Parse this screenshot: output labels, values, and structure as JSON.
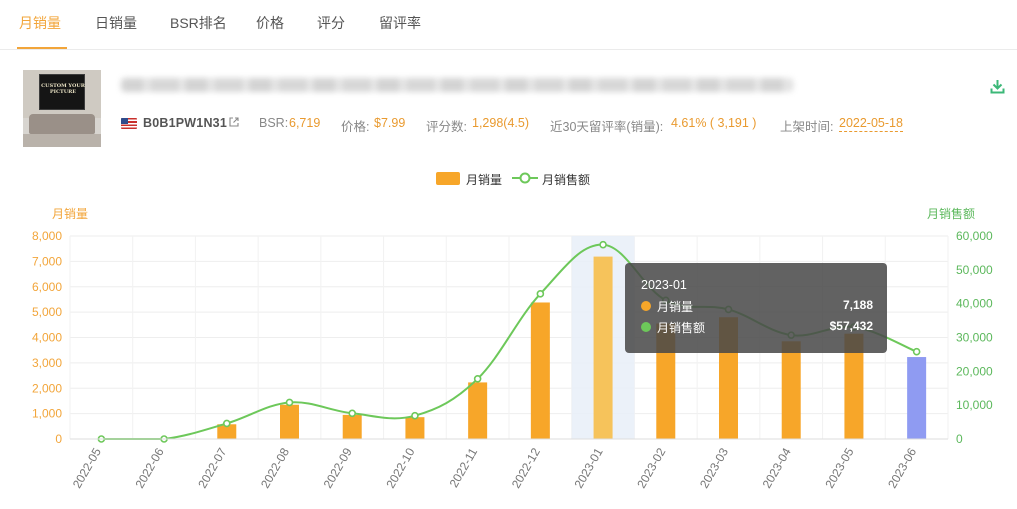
{
  "tabs": [
    {
      "label": "月销量",
      "active": true
    },
    {
      "label": "日销量",
      "active": false
    },
    {
      "label": "BSR排名",
      "active": false
    },
    {
      "label": "价格",
      "active": false
    },
    {
      "label": "评分",
      "active": false
    },
    {
      "label": "留评率",
      "active": false
    }
  ],
  "product": {
    "image_text": "CUSTOM YOUR PICTURE",
    "asin": "B0B1PW1N31",
    "marketplace_flag": "us-flag-icon",
    "bsr_label": "BSR:",
    "bsr_value": "6,719",
    "price_label": "价格:",
    "price_value": "$7.99",
    "ratings_label": "评分数:",
    "ratings_value": "1,298(4.5)",
    "review_rate_label": "近30天留评率(销量):",
    "review_rate_value": "4.61% ( 3,191 )",
    "listed_label": "上架时间:",
    "listed_value": "2022-05-18"
  },
  "icons": {
    "download": "download-icon",
    "external_link": "external-link-icon"
  },
  "colors": {
    "accent": "#f2a53a",
    "bar": "#f7a629",
    "bar_highlight": "#f6c35b",
    "bar_current": "#8f9bf2",
    "line": "#6dc85a",
    "green_text": "#5cb85c"
  },
  "tooltip": {
    "title": "2023-01",
    "rows": [
      {
        "name": "月销量",
        "value": "7,188",
        "color": "#f7a629"
      },
      {
        "name": "月销售额",
        "value": "$57,432",
        "color": "#6dc85a"
      }
    ]
  },
  "chart_data": {
    "type": "bar",
    "categories": [
      "2022-05",
      "2022-06",
      "2022-07",
      "2022-08",
      "2022-09",
      "2022-10",
      "2022-11",
      "2022-12",
      "2023-01",
      "2023-02",
      "2023-03",
      "2023-04",
      "2023-05",
      "2023-06"
    ],
    "series": [
      {
        "name": "月销量",
        "type": "bar",
        "axis": "left",
        "values": [
          0,
          0,
          580,
          1350,
          950,
          860,
          2230,
          5380,
          7188,
          4550,
          4800,
          3850,
          4150,
          3230
        ]
      },
      {
        "name": "月销售额",
        "type": "line",
        "axis": "right",
        "values": [
          0,
          0,
          4600,
          10800,
          7600,
          6900,
          17800,
          42900,
          57432,
          41000,
          38300,
          30700,
          33100,
          25800
        ]
      }
    ],
    "highlight_index": 8,
    "current_index": 13,
    "ylabel_left": "月销量",
    "ylabel_right": "月销售额",
    "ylim_left": [
      0,
      8000
    ],
    "ylim_right": [
      0,
      60000
    ],
    "yticks_left": [
      "0",
      "1,000",
      "2,000",
      "3,000",
      "4,000",
      "5,000",
      "6,000",
      "7,000",
      "8,000"
    ],
    "yticks_right": [
      "0",
      "10,000",
      "20,000",
      "30,000",
      "40,000",
      "50,000",
      "60,000"
    ],
    "legend_placement": "top-center",
    "grid": true
  }
}
